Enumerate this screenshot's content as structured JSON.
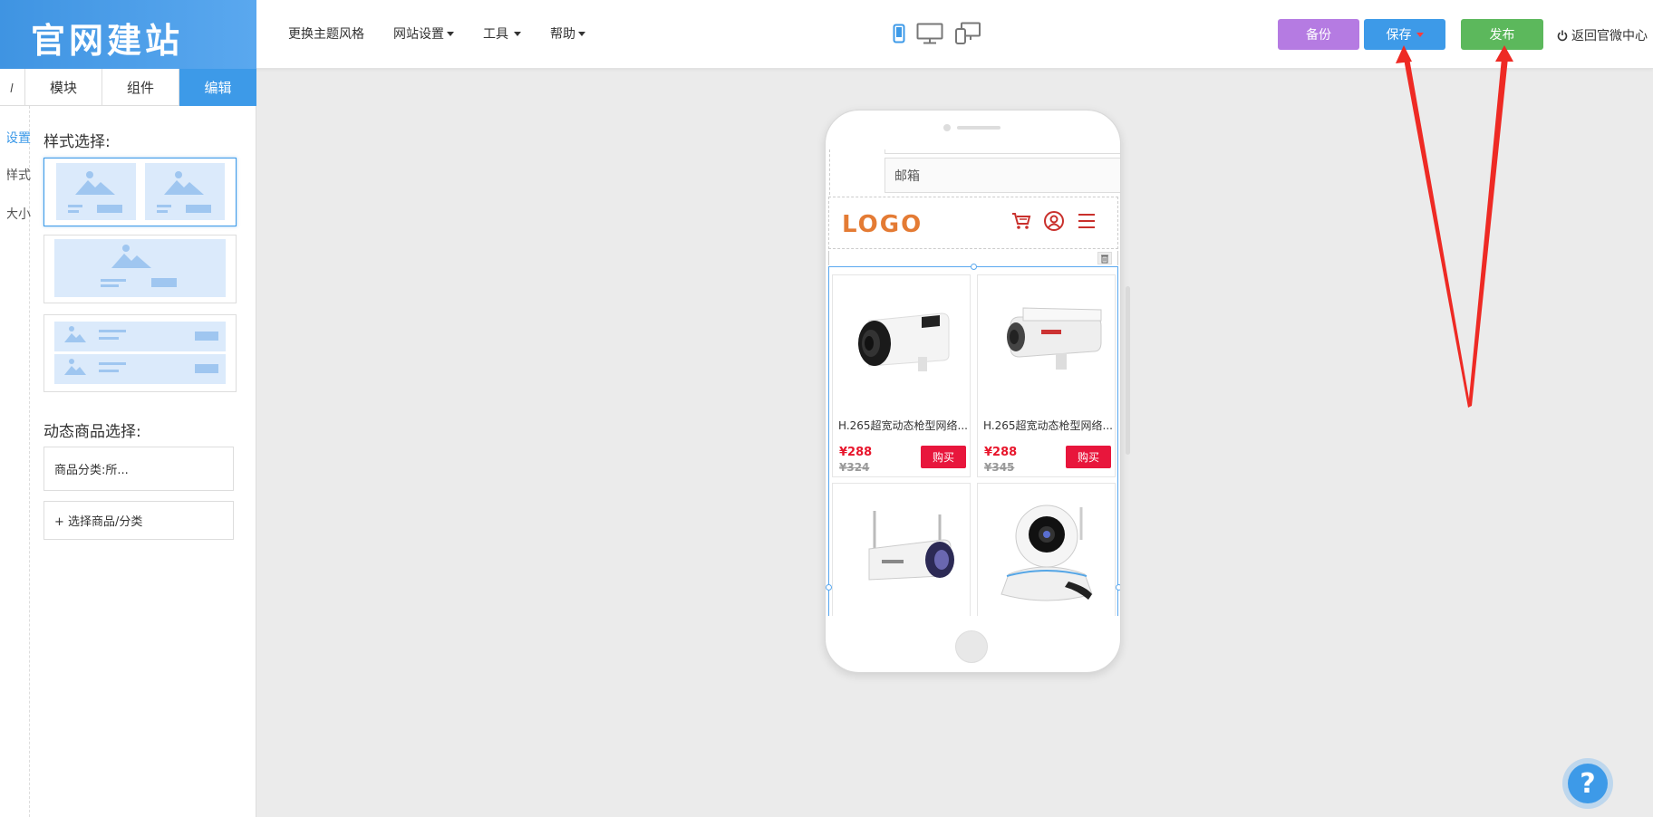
{
  "brand": {
    "title": "官网建站"
  },
  "topnav": {
    "theme": "更换主题风格",
    "site_settings": "网站设置",
    "tools": "工具",
    "help": "帮助"
  },
  "devices": [
    "mobile-icon",
    "desktop-icon",
    "multi-device-icon"
  ],
  "actions": {
    "backup": "备份",
    "save": "保存",
    "publish": "发布",
    "back": "返回官微中心"
  },
  "tabs": [
    "模块",
    "组件",
    "编辑"
  ],
  "sidelist": [
    "设置",
    "样式",
    "大小"
  ],
  "panel": {
    "style_title": "样式选择:",
    "dynamic_title": "动态商品选择:",
    "category_field": "商品分类:所...",
    "select_button": "+ 选择商品/分类"
  },
  "phone": {
    "email_label": "邮箱",
    "logo": "LOGO",
    "products": [
      {
        "name": "H.265超宽动态枪型网络...",
        "price": "¥288",
        "old_price": "¥324",
        "buy": "购买"
      },
      {
        "name": "H.265超宽动态枪型网络...",
        "price": "¥288",
        "old_price": "¥345",
        "buy": "购买"
      }
    ]
  },
  "help": {
    "label": "?"
  },
  "colors": {
    "accent": "#3d9ae8",
    "backup": "#b57be2",
    "publish": "#5cb85c",
    "price": "#e8162c",
    "logo": "#e47b34"
  }
}
